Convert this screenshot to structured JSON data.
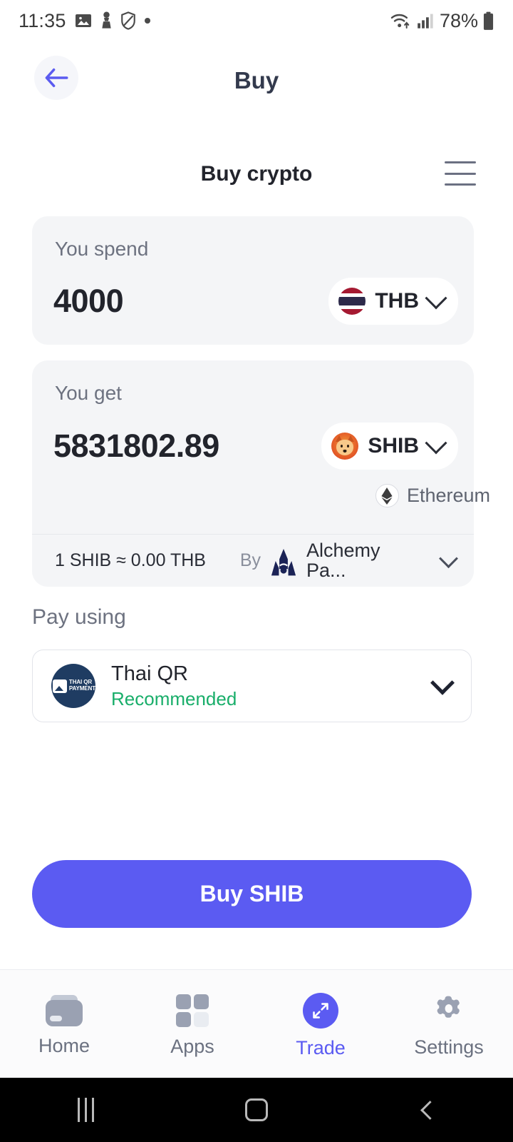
{
  "status_bar": {
    "time": "11:35",
    "battery_percent": "78%",
    "icons": [
      "gallery-icon",
      "chess-pawn-icon",
      "shield-icon",
      "dot-icon"
    ],
    "right_icons": [
      "wifi-icon",
      "signal-icon",
      "battery-icon"
    ]
  },
  "app_bar": {
    "title": "Buy",
    "back_icon": "arrow-left-icon"
  },
  "page_header": {
    "title": "Buy crypto",
    "menu_icon": "hamburger-menu-icon"
  },
  "spend": {
    "label": "You spend",
    "amount": "4000",
    "currency_code": "THB",
    "currency_icon": "thai-flag-icon"
  },
  "get": {
    "label": "You get",
    "amount": "5831802.89",
    "currency_code": "SHIB",
    "currency_icon": "shiba-inu-icon",
    "network": "Ethereum",
    "network_icon": "ethereum-icon"
  },
  "rate": {
    "text": "1 SHIB ≈ 0.00 THB",
    "by_label": "By",
    "provider": "Alchemy Pa...",
    "provider_icon": "alchemy-pay-logo"
  },
  "pay_using": {
    "label": "Pay using",
    "method_name": "Thai QR",
    "method_badge": "Recommended",
    "method_icon": "thai-qr-payment-logo",
    "logo_text_line1": "THAI QR",
    "logo_text_line2": "PAYMENT"
  },
  "cta": {
    "label": "Buy SHIB"
  },
  "bottom_nav": {
    "items": [
      {
        "label": "Home",
        "icon": "wallet-icon",
        "active": false
      },
      {
        "label": "Apps",
        "icon": "grid-icon",
        "active": false
      },
      {
        "label": "Trade",
        "icon": "expand-arrows-icon",
        "active": true
      },
      {
        "label": "Settings",
        "icon": "gear-icon",
        "active": false
      }
    ]
  },
  "system_nav": {
    "recents_icon": "recents-icon",
    "home_icon": "home-square-icon",
    "back_icon": "back-chevron-icon"
  },
  "colors": {
    "accent": "#5B5BF2",
    "card_bg": "#F4F5F7",
    "recommended_green": "#19AE6A",
    "provider_navy": "#1B2356",
    "thaiqr_navy": "#1F3C62"
  }
}
